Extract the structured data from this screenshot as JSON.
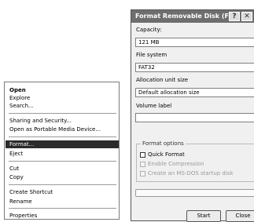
{
  "context_menu": {
    "items": [
      {
        "label": "Open"
      },
      {
        "label": "Explore"
      },
      {
        "label": "Search..."
      },
      {
        "label": "Sharing and Security..."
      },
      {
        "label": "Open as Portable Media Device..."
      },
      {
        "label": "Format..."
      },
      {
        "label": "Eject"
      },
      {
        "label": "Cut"
      },
      {
        "label": "Copy"
      },
      {
        "label": "Create Shortcut"
      },
      {
        "label": "Rename"
      },
      {
        "label": "Properties"
      }
    ],
    "highlighted": "Format..."
  },
  "dialog": {
    "title": "Format Removable Disk (F:)",
    "help_glyph": "?",
    "close_glyph": "✕",
    "capacity": {
      "label": "Capacity:",
      "value": "121 MB"
    },
    "file_system": {
      "label": "File system",
      "value": "FAT32"
    },
    "allocation": {
      "label": "Allocation unit size",
      "value": "Default allocation size"
    },
    "volume": {
      "label": "Volume label",
      "value": ""
    },
    "options": {
      "legend": "Format options",
      "quick": "Quick Format",
      "compression": "Enable Compression",
      "msdos": "Create an MS-DOS startup disk"
    },
    "progress": 0,
    "start_label": "Start",
    "close_label": "Close"
  },
  "colors": {
    "title_bar": "#6e6e6e",
    "menu_highlight": "#2b2b2b",
    "dialog_bg": "#f0f0f0"
  }
}
